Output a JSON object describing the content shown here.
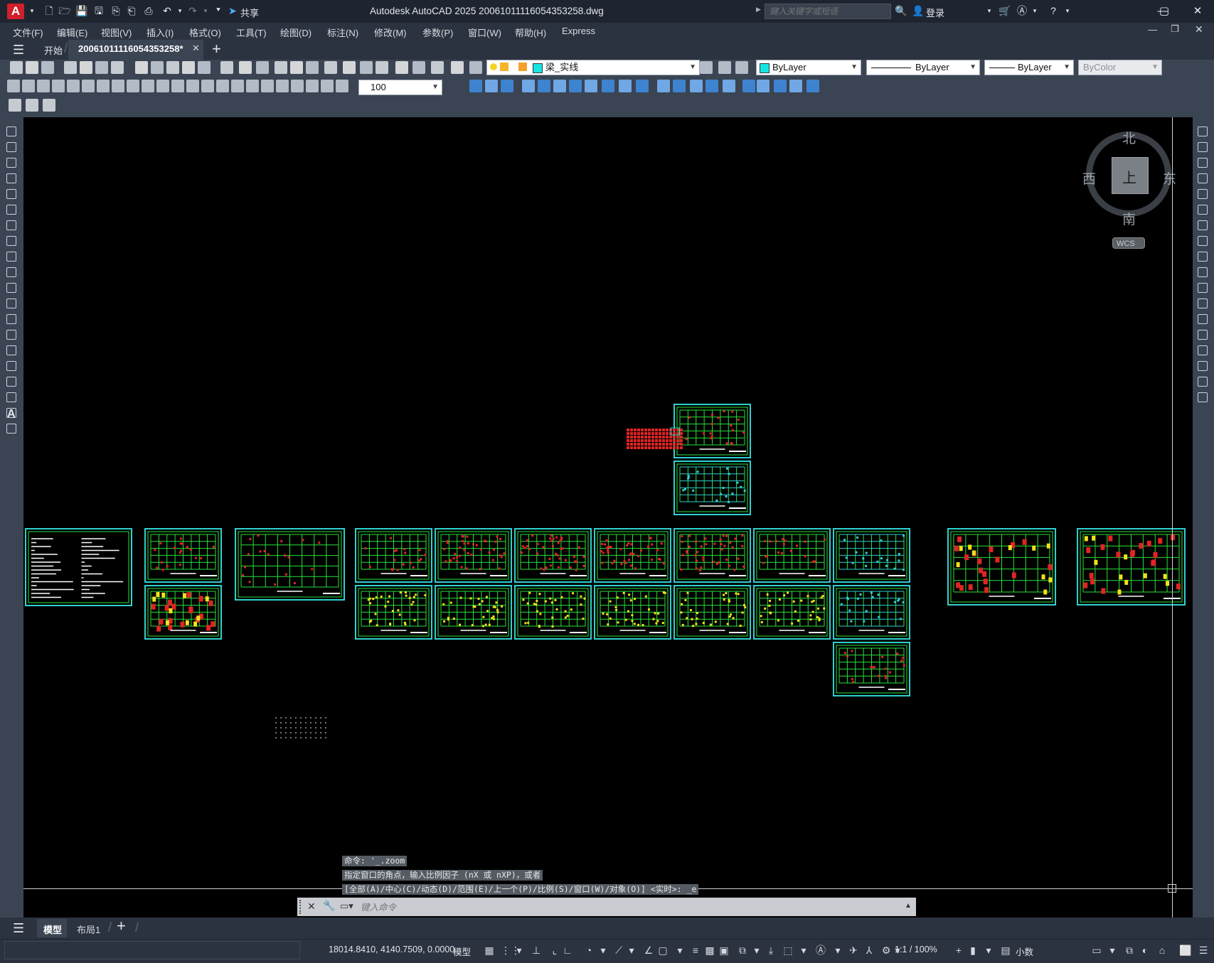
{
  "app": {
    "logo": "A",
    "title": "Autodesk AutoCAD 2025    20061011116054353258.dwg",
    "share_label": "共享"
  },
  "search": {
    "placeholder": "键入关键字或短语"
  },
  "user": {
    "login_label": "登录"
  },
  "menu": [
    "文件(F)",
    "编辑(E)",
    "视图(V)",
    "插入(I)",
    "格式(O)",
    "工具(T)",
    "绘图(D)",
    "标注(N)",
    "修改(M)",
    "参数(P)",
    "窗口(W)",
    "帮助(H)",
    "Express"
  ],
  "tabs": {
    "start": "开始",
    "document": "20061011116054353258*"
  },
  "layer": {
    "current": "梁_实线"
  },
  "properties": {
    "color": "ByLayer",
    "linetype": "ByLayer",
    "lineweight": "ByLayer",
    "plotstyle": "ByColor"
  },
  "dimscale": {
    "value": "100"
  },
  "viewcube": {
    "north": "北",
    "south": "南",
    "east": "东",
    "west": "西",
    "top": "上",
    "wcs": "WCS"
  },
  "command": {
    "history": [
      "命令: '_.zoom",
      "指定窗口的角点，输入比例因子 (nX 或 nXP)，或者",
      "[全部(A)/中心(C)/动态(D)/范围(E)/上一个(P)/比例(S)/窗口(W)/对象(O)] <实时>: _e"
    ],
    "placeholder": "键入命令"
  },
  "layout_tabs": {
    "model": "模型",
    "layout1": "布局1"
  },
  "status": {
    "coords": "18014.8410, 4140.7509, 0.0000",
    "mode": "模型",
    "scale": "1:1 / 100%",
    "units": "小数"
  },
  "colors": {
    "canvas": "#000000",
    "sheet_border": "#2fd0cf",
    "green": "#27e23a",
    "red": "#e02424",
    "yellow": "#f2e21b",
    "accent": "#1f8ad6"
  }
}
